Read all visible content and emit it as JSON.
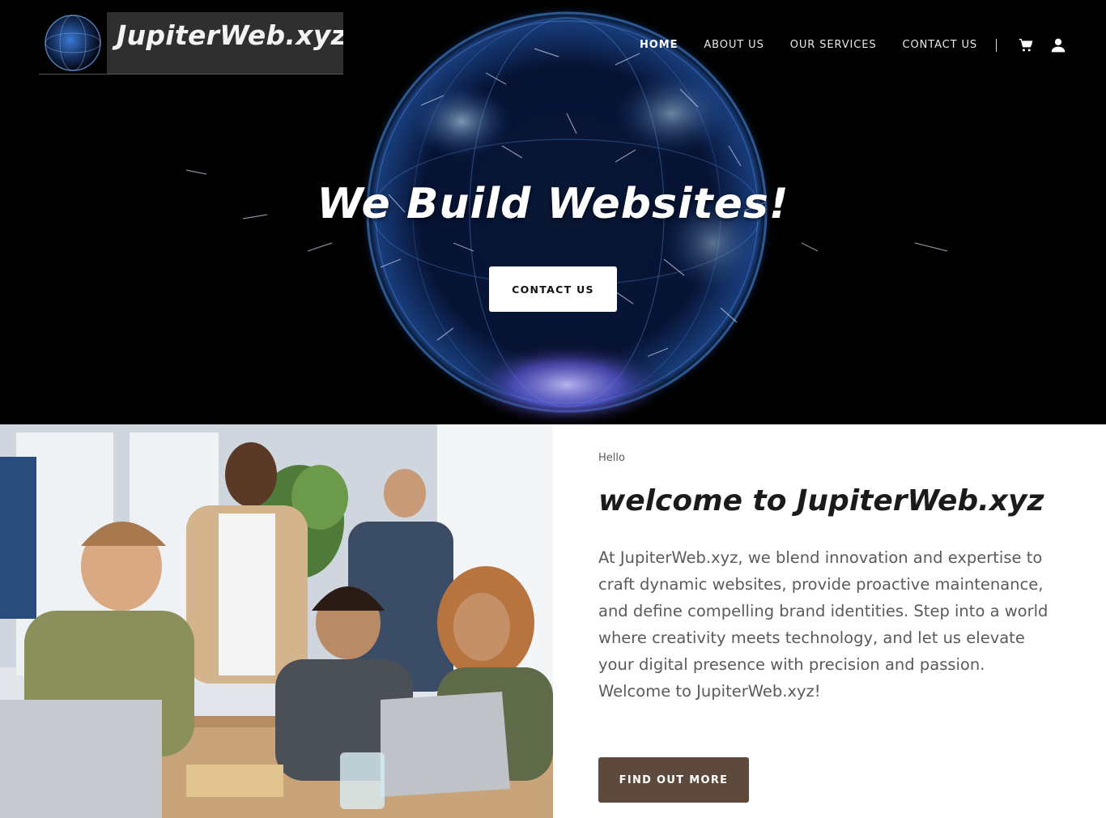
{
  "header": {
    "logo_text": "JupiterWeb.xyz",
    "nav": [
      {
        "label": "HOME",
        "active": true
      },
      {
        "label": "ABOUT US",
        "active": false
      },
      {
        "label": "OUR SERVICES",
        "active": false
      },
      {
        "label": "CONTACT US",
        "active": false
      }
    ],
    "icons": [
      "cart-icon",
      "account-icon"
    ]
  },
  "hero": {
    "title": "We Build Websites!",
    "button_label": "CONTACT US"
  },
  "welcome": {
    "eyebrow": "Hello",
    "heading": "welcome to JupiterWeb.xyz",
    "body": "At JupiterWeb.xyz, we blend innovation and expertise to craft dynamic websites, provide proactive maintenance, and define compelling brand identities. Step into a world where creativity meets technology, and let us elevate your digital presence with precision and passion. Welcome to JupiterWeb.xyz!",
    "button_label": "FIND OUT MORE"
  },
  "colors": {
    "hero_bg": "#000000",
    "globe_blue": "#3a78d8",
    "button_brown": "#5d4a3c",
    "text_gray": "#5a5a5a"
  }
}
